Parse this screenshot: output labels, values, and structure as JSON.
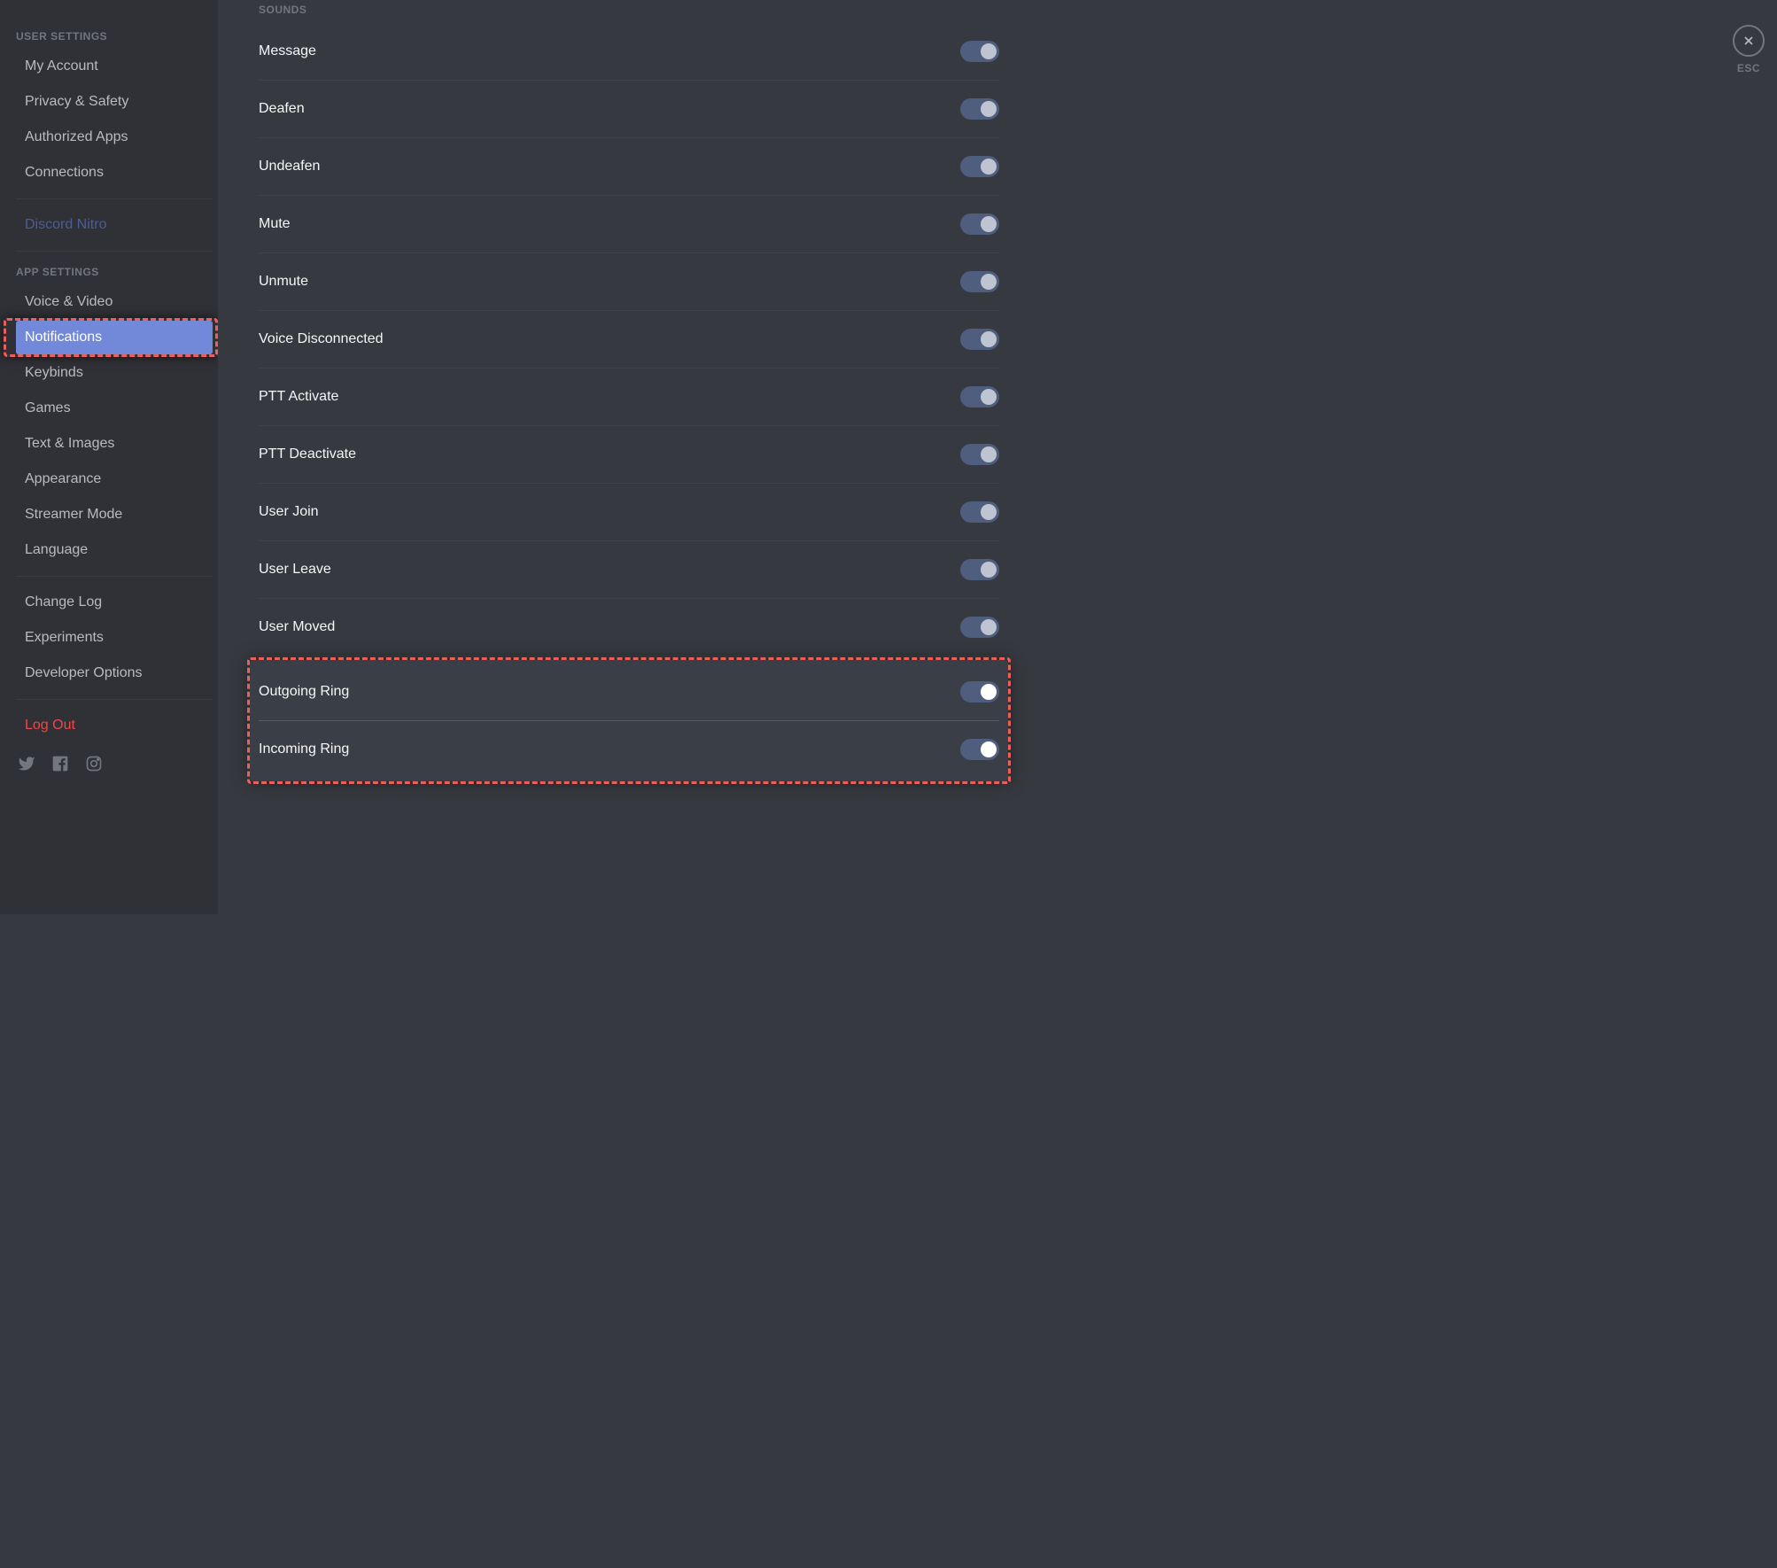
{
  "sidebar": {
    "section_user": "USER SETTINGS",
    "section_app": "APP SETTINGS",
    "items_user": [
      {
        "label": "My Account"
      },
      {
        "label": "Privacy & Safety"
      },
      {
        "label": "Authorized Apps"
      },
      {
        "label": "Connections"
      }
    ],
    "nitro": "Discord Nitro",
    "items_app": [
      {
        "label": "Voice & Video"
      },
      {
        "label": "Notifications"
      },
      {
        "label": "Keybinds"
      },
      {
        "label": "Games"
      },
      {
        "label": "Text & Images"
      },
      {
        "label": "Appearance"
      },
      {
        "label": "Streamer Mode"
      },
      {
        "label": "Language"
      }
    ],
    "items_extra": [
      {
        "label": "Change Log"
      },
      {
        "label": "Experiments"
      },
      {
        "label": "Developer Options"
      }
    ],
    "logout": "Log Out"
  },
  "content": {
    "section_sounds": "SOUNDS",
    "sounds": [
      {
        "label": "Message",
        "state": "on"
      },
      {
        "label": "Deafen",
        "state": "on"
      },
      {
        "label": "Undeafen",
        "state": "on"
      },
      {
        "label": "Mute",
        "state": "on"
      },
      {
        "label": "Unmute",
        "state": "on"
      },
      {
        "label": "Voice Disconnected",
        "state": "on"
      },
      {
        "label": "PTT Activate",
        "state": "on"
      },
      {
        "label": "PTT Deactivate",
        "state": "on"
      },
      {
        "label": "User Join",
        "state": "on"
      },
      {
        "label": "User Leave",
        "state": "on"
      },
      {
        "label": "User Moved",
        "state": "on"
      }
    ],
    "rings": [
      {
        "label": "Outgoing Ring",
        "state": "on"
      },
      {
        "label": "Incoming Ring",
        "state": "on"
      }
    ]
  },
  "close": {
    "esc": "ESC"
  }
}
